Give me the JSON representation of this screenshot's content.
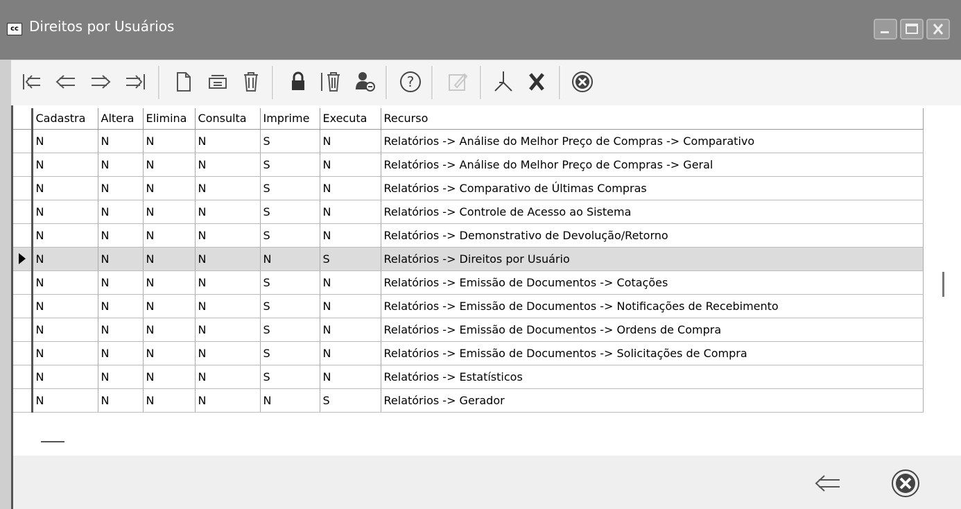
{
  "window": {
    "title": "Direitos por Usuários",
    "app_icon_text": "cc",
    "controls": [
      "minimize-icon",
      "maximize-icon",
      "close-icon"
    ]
  },
  "toolbar": {
    "buttons": [
      {
        "name": "first-record-button",
        "icon": "first-arrow-icon"
      },
      {
        "name": "previous-record-button",
        "icon": "left-arrow-icon"
      },
      {
        "name": "next-record-button",
        "icon": "right-arrow-icon"
      },
      {
        "name": "last-record-button",
        "icon": "last-arrow-icon"
      },
      {
        "name": "new-button",
        "icon": "new-document-icon"
      },
      {
        "name": "edit-button",
        "icon": "edit-folder-icon"
      },
      {
        "name": "delete-button",
        "icon": "trash-icon"
      },
      {
        "name": "lock-button",
        "icon": "lock-icon"
      },
      {
        "name": "delete-all-button",
        "icon": "trash-bars-icon"
      },
      {
        "name": "user-button",
        "icon": "user-icon"
      },
      {
        "name": "help-button",
        "icon": "help-icon"
      },
      {
        "name": "disabled-edit-button",
        "icon": "pencil-icon"
      },
      {
        "name": "pdf-button",
        "icon": "pdf-icon"
      },
      {
        "name": "excel-button",
        "icon": "x-icon"
      },
      {
        "name": "close-button",
        "icon": "circle-x-icon"
      }
    ]
  },
  "grid": {
    "columns": [
      "Cadastra",
      "Altera",
      "Elimina",
      "Consulta",
      "Imprime",
      "Executa",
      "Recurso"
    ],
    "selected_row": 5,
    "rows": [
      [
        "N",
        "N",
        "N",
        "N",
        "S",
        "N",
        "Relatórios -> Análise do Melhor Preço de Compras -> Comparativo"
      ],
      [
        "N",
        "N",
        "N",
        "N",
        "S",
        "N",
        "Relatórios -> Análise do Melhor Preço de Compras -> Geral"
      ],
      [
        "N",
        "N",
        "N",
        "N",
        "S",
        "N",
        "Relatórios -> Comparativo de Últimas Compras"
      ],
      [
        "N",
        "N",
        "N",
        "N",
        "S",
        "N",
        "Relatórios -> Controle de Acesso ao Sistema"
      ],
      [
        "N",
        "N",
        "N",
        "N",
        "S",
        "N",
        "Relatórios -> Demonstrativo de Devolução/Retorno"
      ],
      [
        "N",
        "N",
        "N",
        "N",
        "N",
        "S",
        "Relatórios -> Direitos por Usuário"
      ],
      [
        "N",
        "N",
        "N",
        "N",
        "S",
        "N",
        "Relatórios -> Emissão de Documentos -> Cotações"
      ],
      [
        "N",
        "N",
        "N",
        "N",
        "S",
        "N",
        "Relatórios -> Emissão de Documentos -> Notificações de Recebimento"
      ],
      [
        "N",
        "N",
        "N",
        "N",
        "S",
        "N",
        "Relatórios -> Emissão de Documentos -> Ordens de Compra"
      ],
      [
        "N",
        "N",
        "N",
        "N",
        "S",
        "N",
        "Relatórios -> Emissão de Documentos -> Solicitações de Compra"
      ],
      [
        "N",
        "N",
        "N",
        "N",
        "S",
        "N",
        "Relatórios -> Estatísticos"
      ],
      [
        "N",
        "N",
        "N",
        "N",
        "N",
        "S",
        "Relatórios -> Gerador"
      ]
    ]
  },
  "footer": {
    "buttons": [
      {
        "name": "back-button",
        "icon": "left-arrow-icon"
      },
      {
        "name": "footer-close-button",
        "icon": "circle-x-icon"
      }
    ]
  },
  "colors": {
    "titlebar": "#7f7f7f",
    "selected_row": "#dcdcdc"
  }
}
